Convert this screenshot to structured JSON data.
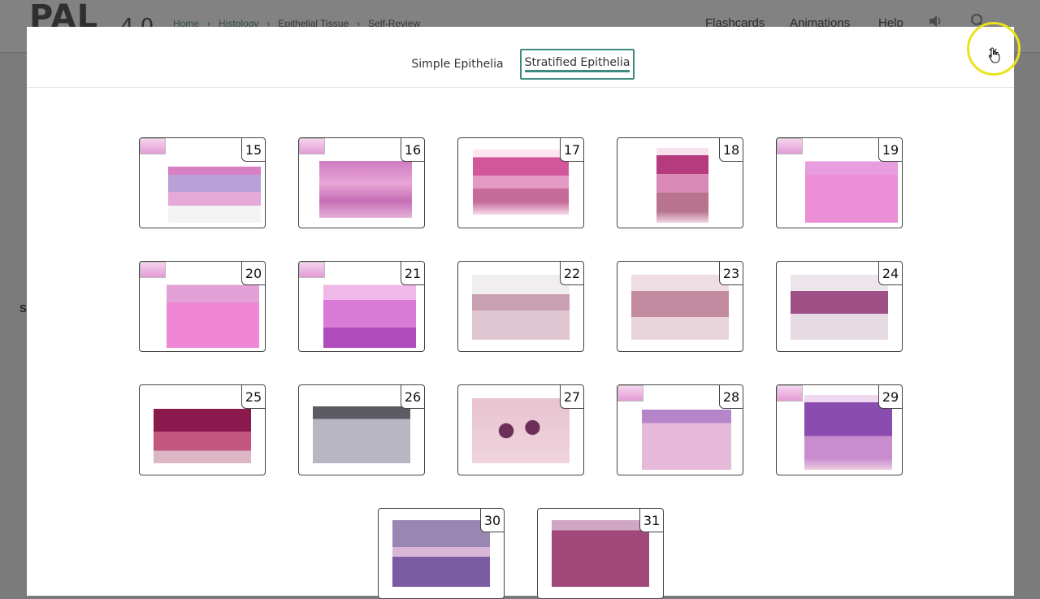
{
  "background": {
    "logo": "PAL",
    "version": "4.0",
    "breadcrumbs": [
      "Home",
      "Histology",
      "Epithelial Tissue",
      "Self-Review"
    ],
    "breadcrumb_separator": "›",
    "nav": [
      "Flashcards",
      "Animations",
      "Help"
    ],
    "side_text": "S"
  },
  "modal": {
    "tabs": [
      {
        "label": "Simple Epithelia",
        "active": false
      },
      {
        "label": "Stratified Epithelia",
        "active": true
      }
    ],
    "close_label": "×",
    "thumbnails": [
      {
        "number": "15"
      },
      {
        "number": "16"
      },
      {
        "number": "17"
      },
      {
        "number": "18"
      },
      {
        "number": "19"
      },
      {
        "number": "20"
      },
      {
        "number": "21"
      },
      {
        "number": "22"
      },
      {
        "number": "23"
      },
      {
        "number": "24"
      },
      {
        "number": "25"
      },
      {
        "number": "26"
      },
      {
        "number": "27"
      },
      {
        "number": "28"
      },
      {
        "number": "29"
      },
      {
        "number": "30"
      },
      {
        "number": "31"
      }
    ]
  },
  "colors": {
    "accent": "#3c8a80",
    "highlight_ring": "#e9e21c"
  }
}
